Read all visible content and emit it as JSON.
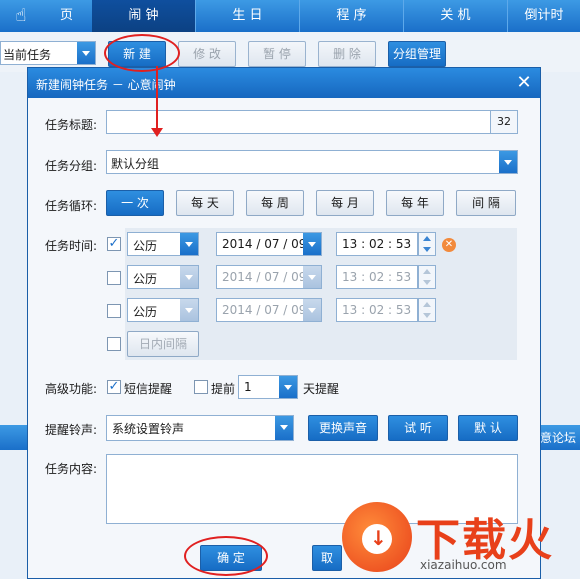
{
  "top_tabs": [
    {
      "label": "页"
    },
    {
      "label": "闹  钟"
    },
    {
      "label": "生  日"
    },
    {
      "label": "程  序"
    },
    {
      "label": "关  机"
    },
    {
      "label": "倒计时"
    }
  ],
  "toolbar": {
    "current_task": "当前任务",
    "new_label": "新 建",
    "edit_label": "修 改",
    "pause_label": "暂 停",
    "delete_label": "删 除",
    "group_manage_label": "分组管理"
  },
  "background": {
    "right_text": "意论坛"
  },
  "dialog": {
    "title": "新建闹钟任务 － 心意闹钟",
    "title_label": "任务标题:",
    "title_value": "",
    "title_counter": "32",
    "group_label": "任务分组:",
    "group_value": "默认分组",
    "repeat_label": "任务循环:",
    "repeat_options": [
      "一 次",
      "每 天",
      "每 周",
      "每 月",
      "每 年",
      "间 隔"
    ],
    "repeat_selected": "一 次",
    "time_label": "任务时间:",
    "time_rows": [
      {
        "calendar": "公历",
        "date": "2014 / 07 / 09",
        "time": "13 : 02 : 53",
        "checked": true
      },
      {
        "calendar": "公历",
        "date": "2014 / 07 / 09",
        "time": "13 : 02 : 53",
        "checked": false
      },
      {
        "calendar": "公历",
        "date": "2014 / 07 / 09",
        "time": "13 : 02 : 53",
        "checked": false
      }
    ],
    "intraday_label": "日内间隔",
    "advanced_label": "高级功能:",
    "sms_label": "短信提醒",
    "advance_label": "提前",
    "advance_days": "1",
    "days_remind_label": "天提醒",
    "ring_label": "提醒铃声:",
    "ring_value": "系统设置铃声",
    "change_sound_label": "更换声音",
    "listen_label": "试 听",
    "default_label": "默 认",
    "content_label": "任务内容:",
    "content_value": "",
    "ok_label": "确 定",
    "cancel_label": "取"
  },
  "watermark": {
    "brand": "下载火",
    "domain": "xiazaihuo.com"
  },
  "colors": {
    "accent": "#1a6fc9",
    "annotation": "#e02020",
    "watermark": "#e8401a"
  }
}
